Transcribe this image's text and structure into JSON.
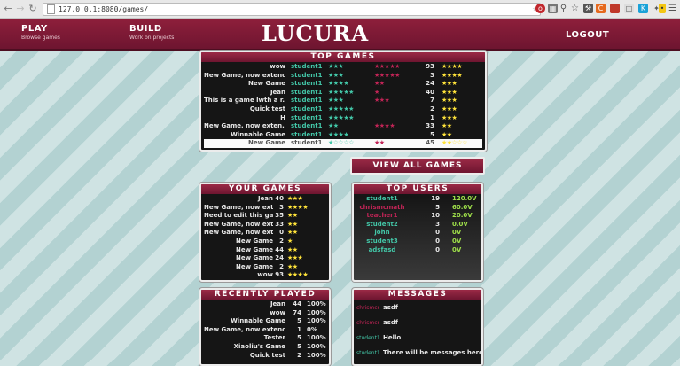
{
  "browser": {
    "url": "127.0.0.1:8080/games/"
  },
  "nav": {
    "play": "PLAY",
    "play_sub": "Browse games",
    "build": "BUILD",
    "build_sub": "Work on projects",
    "logo": "LUCURA",
    "logout": "LOGOUT"
  },
  "top_games": {
    "title": "TOP GAMES",
    "rows": [
      {
        "name": "wow",
        "author": "student1",
        "green": "★★★",
        "red": "★★★★★",
        "count": "93",
        "yellow": "★★★★"
      },
      {
        "name": "New Game, now extend...",
        "author": "student1",
        "green": "★★★",
        "red": "★★★★★",
        "count": "3",
        "yellow": "★★★★"
      },
      {
        "name": "New Game",
        "author": "student1",
        "green": "★★★★",
        "red": "★★",
        "count": "24",
        "yellow": "★★★"
      },
      {
        "name": "Jean",
        "author": "student1",
        "green": "★★★★★",
        "red": "★",
        "count": "40",
        "yellow": "★★★"
      },
      {
        "name": "This is a game lwth a r...",
        "author": "student1",
        "green": "★★★",
        "red": "★★★",
        "count": "7",
        "yellow": "★★★"
      },
      {
        "name": "Quick test",
        "author": "student1",
        "green": "★★★★★",
        "red": "",
        "count": "2",
        "yellow": "★★★"
      },
      {
        "name": "H",
        "author": "student1",
        "green": "★★★★★",
        "red": "",
        "count": "1",
        "yellow": "★★★"
      },
      {
        "name": "New Game, now exten...",
        "author": "student1",
        "green": "★★",
        "red": "★★★★",
        "count": "33",
        "yellow": "★★"
      },
      {
        "name": "Winnable Game",
        "author": "student1",
        "green": "★★★★",
        "red": "",
        "count": "5",
        "yellow": "★★"
      },
      {
        "name": "New Game",
        "author": "student1",
        "green": "★☆☆☆☆",
        "red": "★★",
        "count": "45",
        "yellow": "★★☆☆☆"
      }
    ]
  },
  "view_all_button": "VIEW ALL GAMES",
  "your_games": {
    "title": "YOUR GAMES",
    "rows": [
      {
        "name": "Jean",
        "count": "40",
        "stars": "★★★"
      },
      {
        "name": "New Game, now exten...",
        "count": "3",
        "stars": "★★★★"
      },
      {
        "name": "Need to edit this game",
        "count": "35",
        "stars": "★★"
      },
      {
        "name": "New Game, now exten...",
        "count": "33",
        "stars": "★★"
      },
      {
        "name": "New Game, now exten...",
        "count": "0",
        "stars": "★★"
      },
      {
        "name": "New Game",
        "count": "2",
        "stars": "★"
      },
      {
        "name": "New Game",
        "count": "44",
        "stars": "★★"
      },
      {
        "name": "New Game",
        "count": "24",
        "stars": "★★★"
      },
      {
        "name": "New Game",
        "count": "2",
        "stars": "★★"
      },
      {
        "name": "wow",
        "count": "93",
        "stars": "★★★★"
      }
    ]
  },
  "top_users": {
    "title": "TOP USERS",
    "rows": [
      {
        "name": "student1",
        "count": "19",
        "xp": "120.0V",
        "color": "#43c7a8"
      },
      {
        "name": "chrismcmath",
        "count": "5",
        "xp": "60.0V",
        "color": "#c12456"
      },
      {
        "name": "teacher1",
        "count": "10",
        "xp": "20.0V",
        "color": "#c12456"
      },
      {
        "name": "student2",
        "count": "3",
        "xp": "0.0V",
        "color": "#43c7a8"
      },
      {
        "name": "john",
        "count": "0",
        "xp": "0V",
        "color": "#43c7a8"
      },
      {
        "name": "student3",
        "count": "0",
        "xp": "0V",
        "color": "#43c7a8"
      },
      {
        "name": "adsfasd",
        "count": "0",
        "xp": "0V",
        "color": "#43c7a8"
      }
    ]
  },
  "recently_played": {
    "title": "RECENTLY PLAYED",
    "rows": [
      {
        "name": "Jean",
        "count": "44",
        "pct": "100%"
      },
      {
        "name": "wow",
        "count": "74",
        "pct": "100%"
      },
      {
        "name": "Winnable Game",
        "count": "5",
        "pct": "100%"
      },
      {
        "name": "New Game, now extended wi...",
        "count": "1",
        "pct": "0%"
      },
      {
        "name": "Tester",
        "count": "5",
        "pct": "100%"
      },
      {
        "name": "Xiaoliu's Game",
        "count": "5",
        "pct": "100%"
      },
      {
        "name": "Quick test",
        "count": "2",
        "pct": "100%"
      }
    ]
  },
  "messages": {
    "title": "MESSAGES",
    "rows": [
      {
        "from": "chrismcmath:",
        "text": "asdf",
        "color": "#c12456"
      },
      {
        "from": "chrismcmath:",
        "text": "asdf",
        "color": "#c12456"
      },
      {
        "from": "student1:",
        "text": "Hello",
        "color": "#43c7a8"
      },
      {
        "from": "student1:",
        "text": "There will be messages here",
        "color": "#43c7a8"
      }
    ]
  }
}
